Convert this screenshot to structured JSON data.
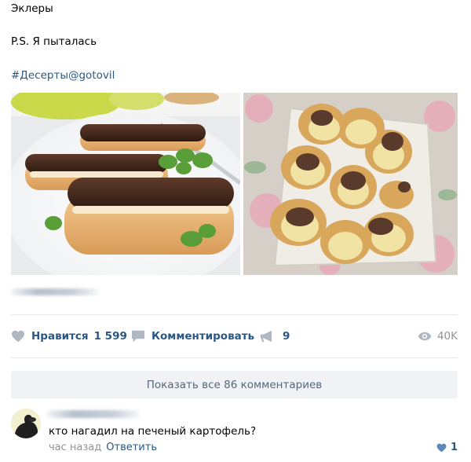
{
  "post": {
    "line1": "Эклеры",
    "line2": "P.S. Я пыталась",
    "hashtag": "#Десерты@gotovil"
  },
  "actions": {
    "like_label": "Нравится",
    "like_count": "1 599",
    "comment_label": "Комментировать",
    "share_count": "9",
    "views_count": "40K"
  },
  "comments": {
    "show_all": "Показать все 86 комментариев",
    "first": {
      "text": "кто нагадил на печеный картофель?",
      "time": "час назад",
      "reply": "Ответить",
      "likes": "1"
    }
  },
  "colors": {
    "link": "#2a5885",
    "muted": "#939393",
    "icon": "#aeb7c2",
    "button_bg": "#f0f2f5"
  }
}
